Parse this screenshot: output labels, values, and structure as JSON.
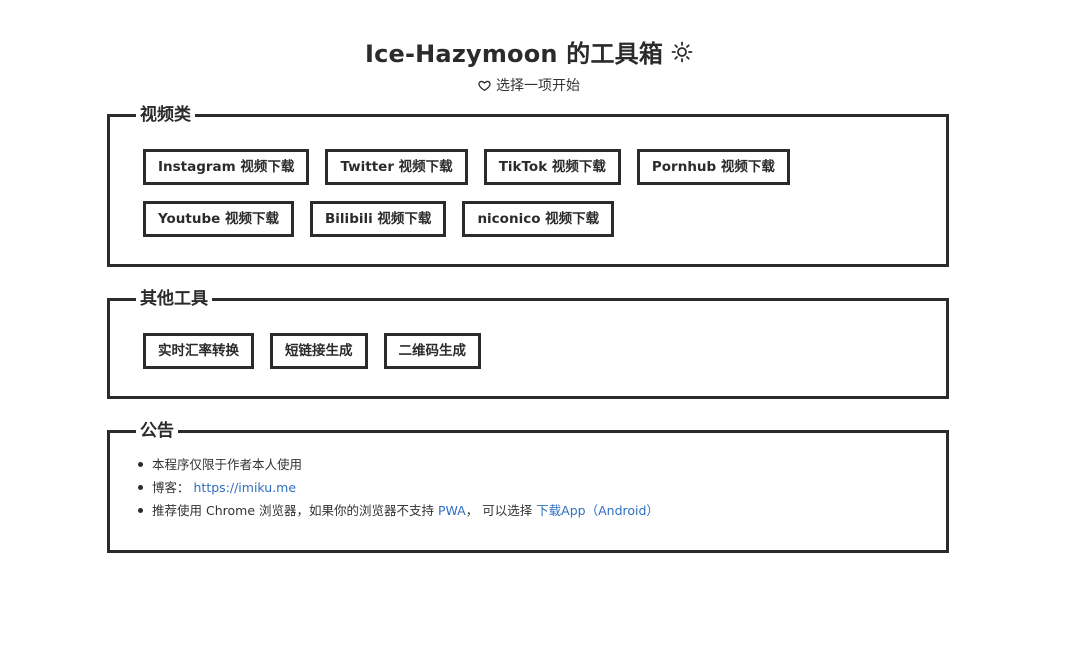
{
  "header": {
    "title": "Ice-Hazymoon 的工具箱",
    "theme_icon": "sun-icon",
    "subtitle": "选择一项开始",
    "subtitle_icon": "heart-icon"
  },
  "video_section": {
    "legend": "视频类",
    "buttons": [
      "Instagram 视频下载",
      "Twitter 视频下载",
      "TikTok 视频下载",
      "Pornhub 视频下载",
      "Youtube 视频下载",
      "Bilibili 视频下载",
      "niconico 视频下载"
    ]
  },
  "other_section": {
    "legend": "其他工具",
    "buttons": [
      "实时汇率转换",
      "短链接生成",
      "二维码生成"
    ]
  },
  "notice_section": {
    "legend": "公告",
    "item1": "本程序仅限于作者本人使用",
    "item2_label": "博客：",
    "item2_link": "https://imiku.me",
    "item3_text1": "推荐使用 Chrome 浏览器，如果你的浏览器不支持 ",
    "item3_link1": "PWA",
    "item3_text2": "， 可以选择 ",
    "item3_link2": "下载App（Android）"
  },
  "colors": {
    "text": "#2b2b2b",
    "link": "#2f6fc0",
    "background": "#ffffff"
  }
}
